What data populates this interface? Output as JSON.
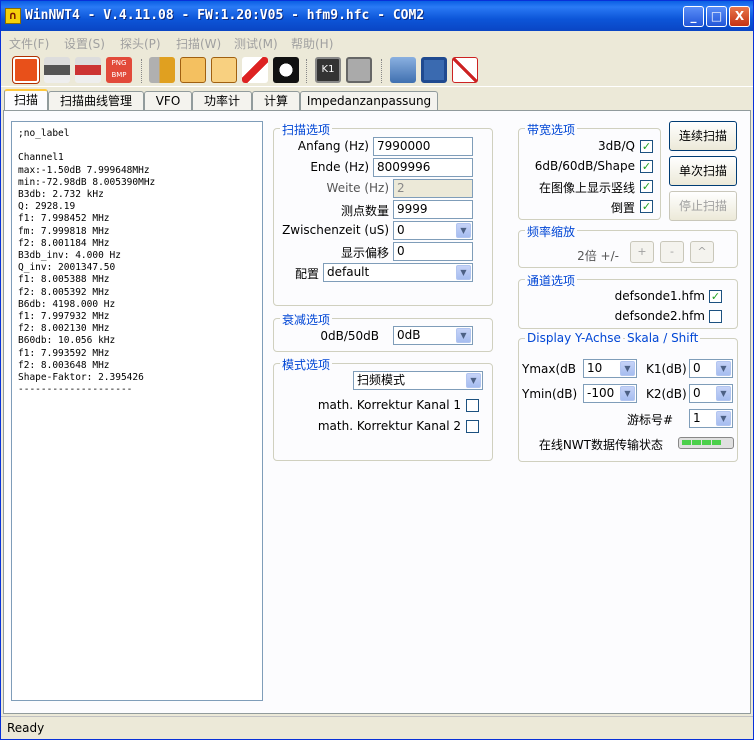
{
  "window": {
    "title": "WinNWT4 - V.4.11.08 - FW:1.20:V05 - hfm9.hfc - COM2",
    "min": "_",
    "max": "□",
    "close": "X"
  },
  "menu": [
    "文件(F)",
    "设置(S)",
    "探头(P)",
    "扫描(W)",
    "测试(M)",
    "帮助(H)"
  ],
  "toolbar_icons": [
    "power-icon",
    "print-icon",
    "print-color-icon",
    "png-bmp-icon",
    "tools-icon",
    "chart-icon",
    "chart-label-icon",
    "pen-icon",
    "penguin-icon",
    "k1-icon",
    "settings-icon",
    "open-icon",
    "save-icon",
    "envelope-icon"
  ],
  "tabs": [
    "扫描",
    "扫描曲线管理",
    "VFO",
    "功率计",
    "计算",
    "Impedanzanpassung"
  ],
  "output_text": ";no_label\n\nChannel1\nmax:-1.50dB 7.999648MHz\nmin:-72.98dB 8.005390MHz\nB3db: 2.732 kHz\nQ: 2928.19\nf1: 7.998452 MHz\nfm: 7.999818 MHz\nf2: 8.001184 MHz\nB3db_inv: 4.000 Hz\nQ_inv: 2001347.50\nf1: 8.005388 MHz\nf2: 8.005392 MHz\nB6db: 4198.000 Hz\nf1: 7.997932 MHz\nf2: 8.002130 MHz\nB60db: 10.056 kHz\nf1: 7.993592 MHz\nf2: 8.003648 MHz\nShape-Faktor: 2.395426\n--------------------",
  "scan": {
    "title": "扫描选项",
    "anfang_label": "Anfang (Hz)",
    "anfang": "7990000",
    "ende_label": "Ende (Hz)",
    "ende": "8009996",
    "weite_label": "Weite (Hz)",
    "weite": "2",
    "points_label": "测点数量",
    "points": "9999",
    "zwischen_label": "Zwischenzeit (uS)",
    "zwischen": "0",
    "offset_label": "显示偏移",
    "offset": "0",
    "config_label": "配置",
    "config": "default"
  },
  "atten": {
    "title": "衰减选项",
    "label": "0dB/50dB",
    "value": "0dB"
  },
  "mode": {
    "title": "模式选项",
    "value": "扫频模式",
    "k1": "math. Korrektur Kanal 1",
    "k2": "math. Korrektur Kanal 2"
  },
  "bw": {
    "title": "带宽选项",
    "o1": "3dB/Q",
    "o2": "6dB/60dB/Shape",
    "o3": "在图像上显示竖线",
    "o4": "倒置"
  },
  "buttons": {
    "continuous": "连续扫描",
    "single": "单次扫描",
    "stop": "停止扫描"
  },
  "zoom": {
    "title": "频率缩放",
    "label": "2倍 +/-",
    "plus": "+",
    "minus": "-",
    "up": "^"
  },
  "channel": {
    "title": "通道选项",
    "c1": "defsonde1.hfm",
    "c2": "defsonde2.hfm"
  },
  "display": {
    "title": "Display Y-Achse",
    "title2": "Skala / Shift",
    "ymax_label": "Ymax(dB",
    "ymax": "10",
    "k1_label": "K1(dB)",
    "k1": "0",
    "ymin_label": "Ymin(dB)",
    "ymin": "-100",
    "k2_label": "K2(dB)",
    "k2": "0",
    "marker_label": "游标号#",
    "marker": "1",
    "status_label": "在线NWT数据传输状态"
  },
  "status": "Ready"
}
